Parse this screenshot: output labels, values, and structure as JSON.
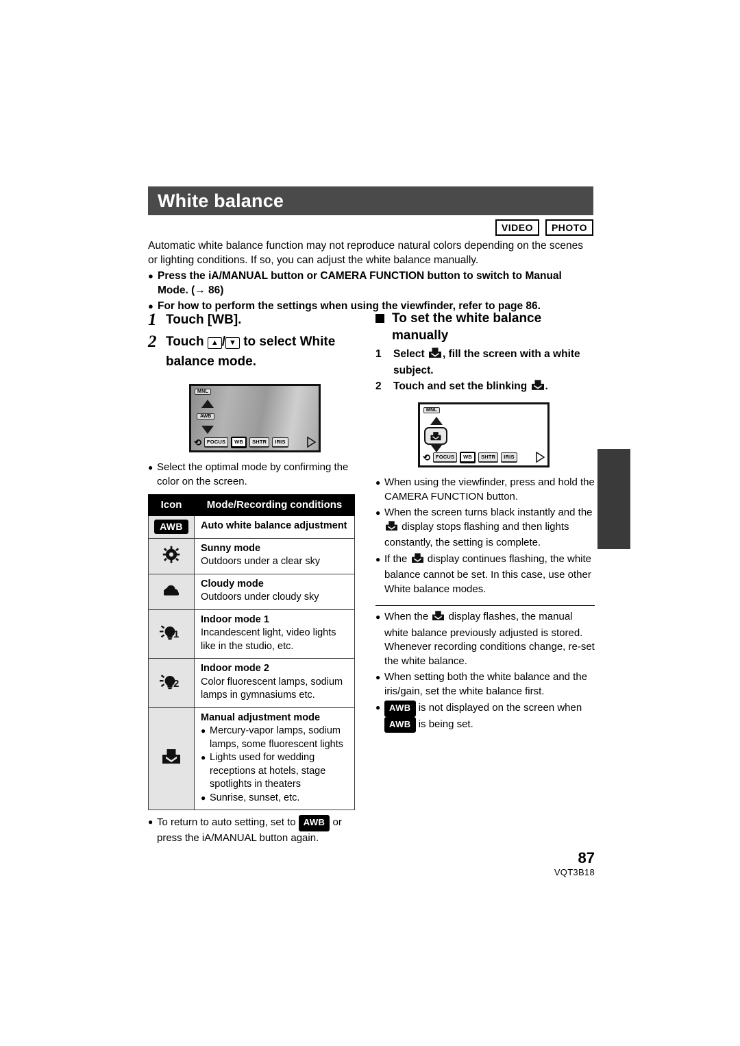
{
  "document": {
    "section_title": "White balance",
    "media_badges": [
      "VIDEO",
      "PHOTO"
    ],
    "page_number": "87",
    "doc_code": "VQT3B18"
  },
  "intro": {
    "paragraph": "Automatic white balance function may not reproduce natural colors depending on the scenes or lighting conditions. If so, you can adjust the white balance manually.",
    "bullets": [
      "Press the iA/MANUAL button or CAMERA FUNCTION button to switch to Manual Mode. (→ 86)",
      "For how to perform the settings when using the viewfinder, refer to page 86."
    ]
  },
  "left_column": {
    "steps": [
      {
        "number": "1",
        "text_before": "Touch [WB].",
        "text_after": ""
      },
      {
        "number": "2",
        "text_before": "Touch",
        "text_after": "to select White balance mode."
      }
    ],
    "screen": {
      "mnl_label": "MNL",
      "mode_chip": "AWB",
      "buttons": [
        "FOCUS",
        "WB",
        "SHTR",
        "IRIS"
      ],
      "highlighted_button": "WB"
    },
    "note": "Select the optimal mode by confirming the color on the screen.",
    "table": {
      "headers": [
        "Icon",
        "Mode/Recording conditions"
      ],
      "rows": [
        {
          "icon_type": "awb-chip",
          "icon_label": "AWB",
          "mode": "Auto white balance adjustment",
          "conditions": "",
          "list": []
        },
        {
          "icon_type": "sunny-icon",
          "icon_label": "",
          "mode": "Sunny mode",
          "conditions": "Outdoors under a clear sky",
          "list": []
        },
        {
          "icon_type": "cloudy-icon",
          "icon_label": "",
          "mode": "Cloudy mode",
          "conditions": "Outdoors under cloudy sky",
          "list": []
        },
        {
          "icon_type": "indoor1-icon",
          "icon_label": "1",
          "mode": "Indoor mode 1",
          "conditions": "Incandescent light, video lights like in the studio, etc.",
          "list": []
        },
        {
          "icon_type": "indoor2-icon",
          "icon_label": "2",
          "mode": "Indoor mode 2",
          "conditions": "Color fluorescent lamps, sodium lamps in gymnasiums etc.",
          "list": []
        },
        {
          "icon_type": "manual-wb-icon",
          "icon_label": "",
          "mode": "Manual adjustment mode",
          "conditions": "",
          "list": [
            "Mercury-vapor lamps, sodium lamps, some fluorescent lights",
            "Lights used for wedding receptions at hotels, stage spotlights in theaters",
            "Sunrise, sunset, etc."
          ]
        }
      ]
    },
    "footer_note": {
      "before": "To return to auto setting, set to",
      "chip": "AWB",
      "after": "or press the iA/MANUAL button again."
    }
  },
  "right_column": {
    "heading": "To set the white balance manually",
    "steps": [
      {
        "number": "1",
        "before": "Select",
        "after": ", fill the screen with a white subject."
      },
      {
        "number": "2",
        "before": "Touch and set the blinking",
        "after": "."
      }
    ],
    "screen": {
      "mnl_label": "MNL",
      "buttons": [
        "FOCUS",
        "WB",
        "SHTR",
        "IRIS"
      ],
      "highlighted_button": "WB"
    },
    "notes_group_1": [
      {
        "before": "When using the viewfinder, press and hold the CAMERA FUNCTION button.",
        "after": ""
      },
      {
        "before": "When the screen turns black instantly and the",
        "after": "display stops flashing and then lights constantly, the setting is complete."
      },
      {
        "before": "If the",
        "after": "display continues flashing, the white balance cannot be set. In this case, use other White balance modes."
      }
    ],
    "notes_group_2": [
      {
        "before": "When the",
        "after": "display flashes, the manual white balance previously adjusted is stored. Whenever recording conditions change, re-set the white balance."
      },
      {
        "before": "When setting both the white balance and the iris/gain, set the white balance first.",
        "after": ""
      },
      {
        "before": "",
        "chip1": "AWB",
        "mid": "is not displayed on the screen when",
        "chip2": "AWB",
        "after": "is being set."
      }
    ]
  },
  "colors": {
    "title_bar": "#4a4a4a",
    "table_header": "#000000",
    "icon_cell": "#e4e4e4",
    "edge_tab": "#3a3a3a"
  }
}
